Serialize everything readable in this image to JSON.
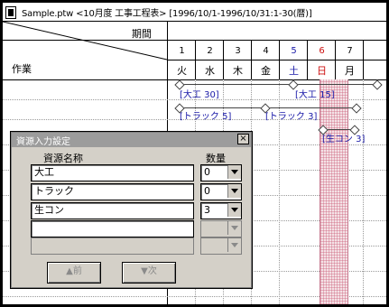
{
  "window": {
    "title": "Sample.ptw <10月度 工事工程表> [1996/10/1-1996/10/31:1-30(暦)]",
    "icon": "document-icon"
  },
  "chart": {
    "period_label": "期間",
    "task_label": "作業",
    "days": [
      {
        "num": "1",
        "name": "火",
        "color": "#000000"
      },
      {
        "num": "2",
        "name": "水",
        "color": "#000000"
      },
      {
        "num": "3",
        "name": "木",
        "color": "#000000"
      },
      {
        "num": "4",
        "name": "金",
        "color": "#000000"
      },
      {
        "num": "5",
        "name": "土",
        "color": "#1a1aa8"
      },
      {
        "num": "6",
        "name": "日",
        "color": "#cc1010"
      },
      {
        "num": "7",
        "name": "月",
        "color": "#000000"
      }
    ],
    "bars": [
      {
        "label": "[大工 30]"
      },
      {
        "label": "[大工 15]"
      },
      {
        "label": "[トラック 5]"
      },
      {
        "label": "[トラック 3]"
      },
      {
        "label": "[生コン 3]"
      }
    ]
  },
  "dialog": {
    "title": "資源入力設定",
    "close_glyph": "×",
    "col_name": "資源名称",
    "col_qty": "数量",
    "rows": [
      {
        "name": "大工",
        "qty": "0"
      },
      {
        "name": "トラック",
        "qty": "0"
      },
      {
        "name": "生コン",
        "qty": "3"
      },
      {
        "name": "",
        "qty": ""
      },
      {
        "name": "",
        "qty": ""
      }
    ],
    "prev_label": "▲前",
    "next_label": "▼次"
  }
}
